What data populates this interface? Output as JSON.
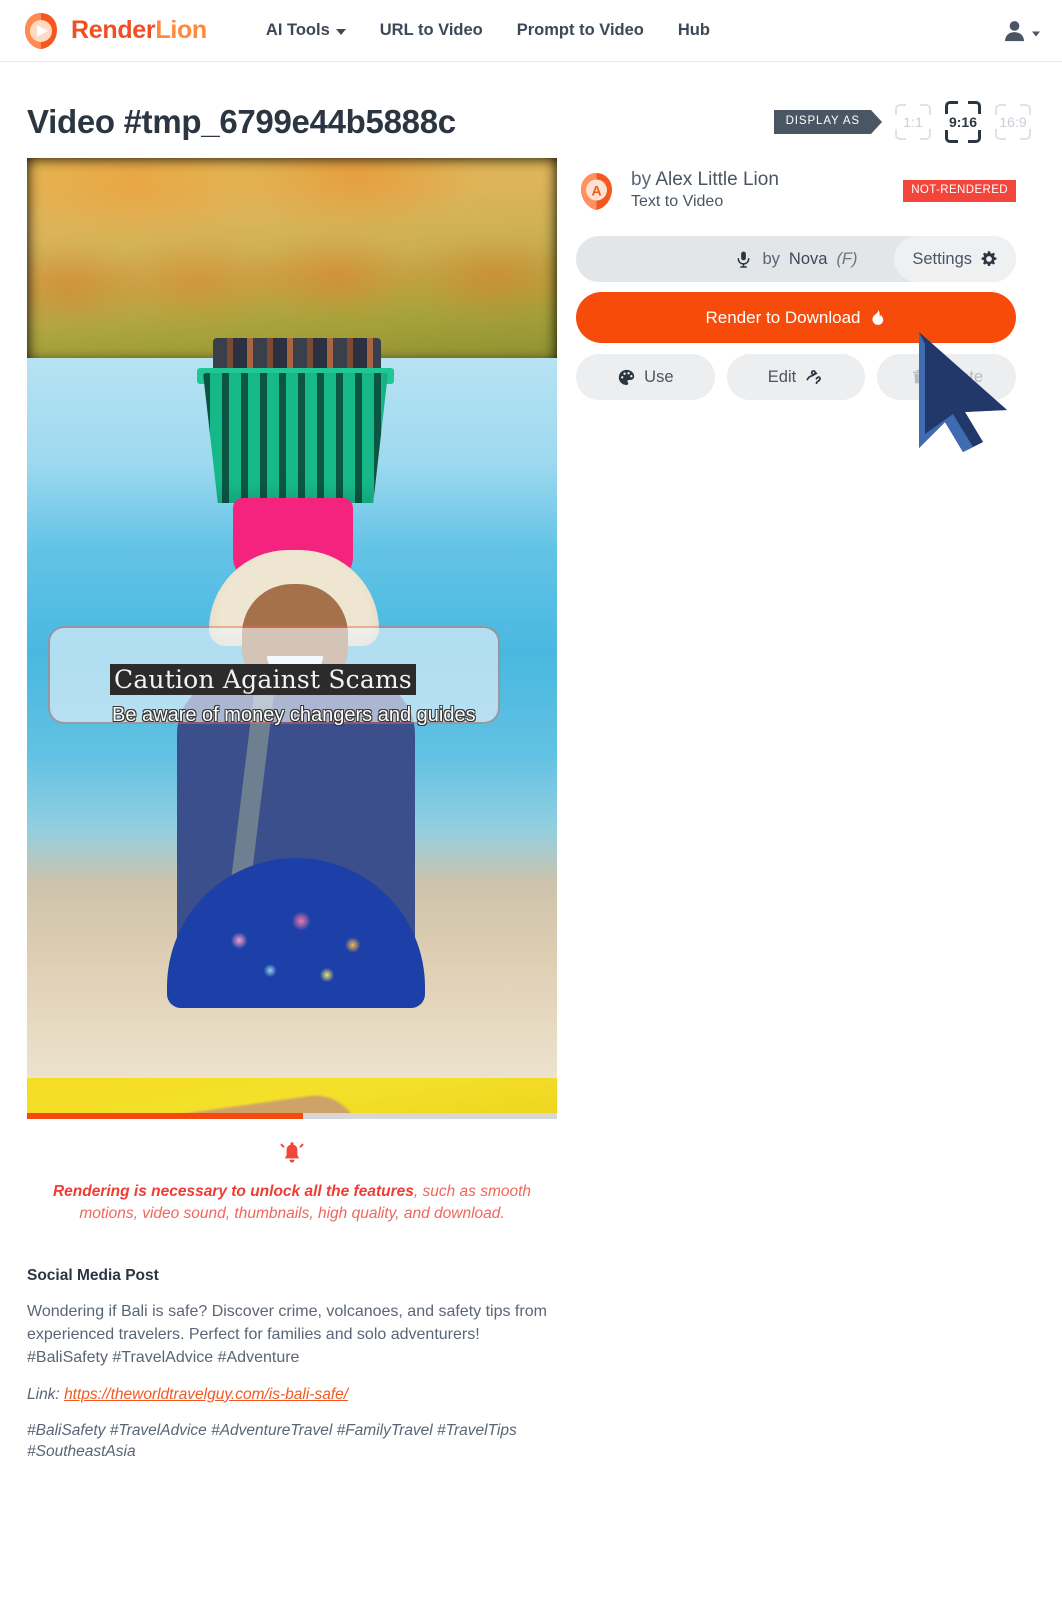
{
  "header": {
    "logo": {
      "part1": "Render",
      "part2": "Lion",
      "icon": "lion-play-logo"
    },
    "nav": [
      {
        "label": "AI Tools",
        "has_dropdown": true
      },
      {
        "label": "URL to Video",
        "has_dropdown": false
      },
      {
        "label": "Prompt to Video",
        "has_dropdown": false
      },
      {
        "label": "Hub",
        "has_dropdown": false
      }
    ],
    "user_menu": {
      "icon": "user-icon",
      "caret": "chevron-down-icon"
    }
  },
  "page": {
    "title": "Video #tmp_6799e44b5888c",
    "display_as_label": "DISPLAY AS",
    "ratios": [
      {
        "label": "1:1",
        "selected": false
      },
      {
        "label": "9:16",
        "selected": true
      },
      {
        "label": "16:9",
        "selected": false
      }
    ]
  },
  "video": {
    "caption_title": "Caution Against Scams",
    "caption_subtitle": "Be aware of money changers and guides",
    "progress_percent": 52
  },
  "warning": {
    "icon": "alarm-bell-icon",
    "bold": "Rendering is necessary to unlock all the features",
    "rest": ", such as smooth motions, video sound, thumbnails, high quality, and download."
  },
  "social": {
    "heading": "Social Media Post",
    "body": "Wondering if Bali is safe? Discover crime, volcanoes, and safety tips from experienced travelers. Perfect for families and solo adventurers! #BaliSafety #TravelAdvice #Adventure",
    "link_label": "Link:",
    "link_url": "https://theworldtravelguy.com/is-bali-safe/",
    "tags": "#BaliSafety #TravelAdvice #AdventureTravel #FamilyTravel #TravelTips #SoutheastAsia"
  },
  "panel": {
    "author_by": "by",
    "author_name": "Alex Little Lion",
    "author_sub": "Text to Video",
    "status": "NOT-RENDERED",
    "avatar_letter": "A",
    "voice_by": "by",
    "voice_name": "Nova",
    "voice_gender": "(F)",
    "settings_label": "Settings",
    "render_label": "Render to Download",
    "use_label": "Use",
    "edit_label": "Edit",
    "delete_label": "Delete"
  },
  "colors": {
    "brand_orange": "#f74b0c",
    "logo_orange_light": "#ff8a3d",
    "logo_orange_dark": "#f04e23",
    "slate": "#4a5664",
    "danger_red": "#f4453c",
    "warn_red": "#f0665c",
    "link_orange": "#f05a22"
  }
}
